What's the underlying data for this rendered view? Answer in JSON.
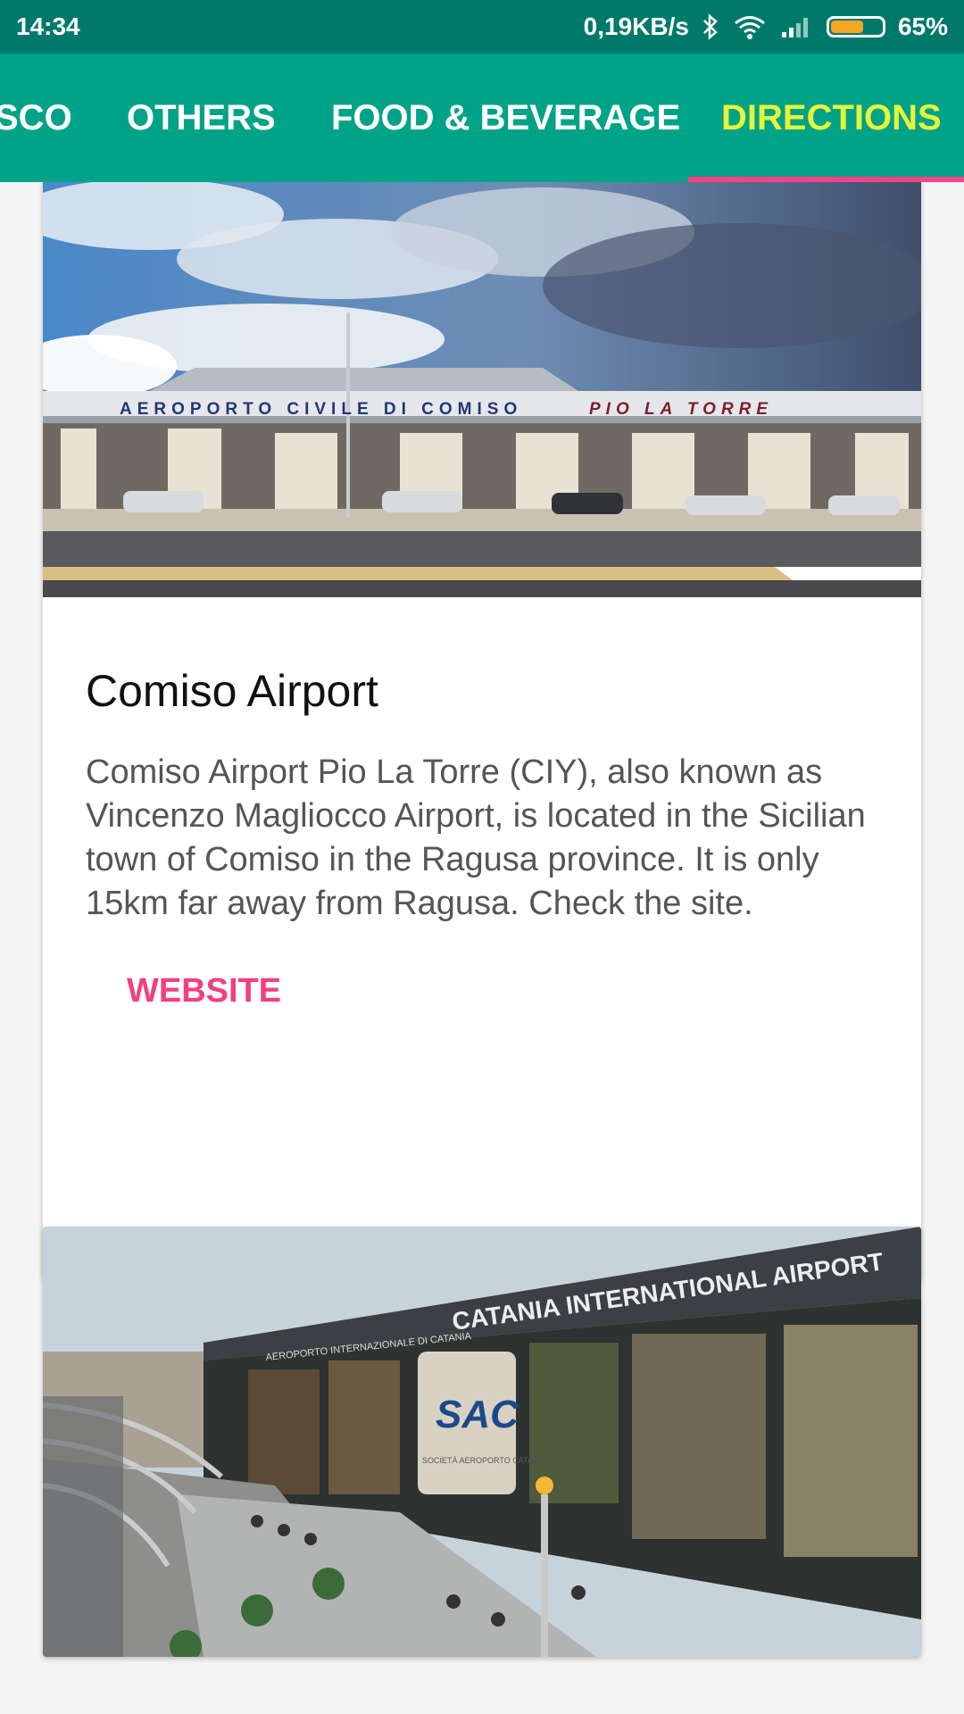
{
  "status_bar": {
    "time": "14:34",
    "network_speed": "0,19KB/s",
    "battery_percent": "65%",
    "battery_level": 0.65,
    "icons": [
      "bluetooth-icon",
      "wifi-icon",
      "cellular-signal-icon",
      "battery-icon"
    ]
  },
  "tabs": [
    {
      "label": "SCO",
      "active": false
    },
    {
      "label": "OTHERS",
      "active": false
    },
    {
      "label": "FOOD & BEVERAGE",
      "active": false
    },
    {
      "label": "DIRECTIONS",
      "active": true
    }
  ],
  "colors": {
    "tab_bar": "#00a388",
    "status_bar": "#00796b",
    "active_tab": "#e7f43a",
    "indicator": "#ff4081",
    "action": "#f0417e"
  },
  "cards": [
    {
      "image_sign_left": "AEROPORTO CIVILE DI COMISO",
      "image_sign_right": "PIO LA TORRE",
      "title": "Comiso Airport",
      "description": "Comiso Airport Pio La Torre (CIY), also known as Vincenzo Magliocco Airport, is located in the Sicilian town of Comiso in the Ragusa province. It is only 15km far away from Ragusa. Check the site.",
      "action_label": "WEBSITE"
    },
    {
      "image_sign_main": "CATANIA INTERNATIONAL AIRPORT",
      "image_sign_small": "AEROPORTO INTERNAZIONALE DI CATANIA",
      "image_logo": "SAC",
      "image_logo_sub": "SOCIETÀ AEROPORTO CATANIA"
    }
  ]
}
